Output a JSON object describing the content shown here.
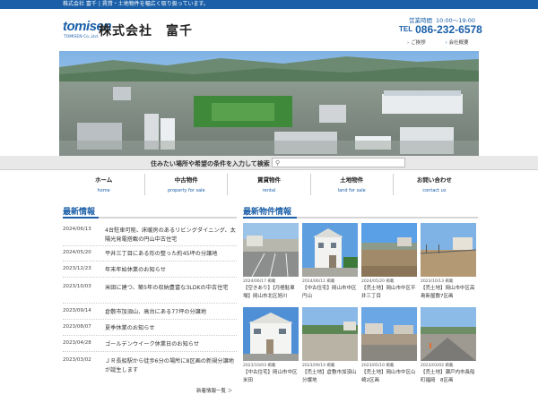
{
  "topbar": {
    "text": "株式会社 富千 | 賃貸・土地物件を幅広く取り扱っています。"
  },
  "header": {
    "logo_mark": "tomisen",
    "logo_sub": "TOMISEN Co.,Ltd.",
    "company_name": "株式会社　富千",
    "hours_label": "営業時間",
    "hours_value": "10:00～19:00",
    "tel_label": "TEL",
    "tel_number": "086-232-6578",
    "links": [
      "ご挨拶",
      "会社概要"
    ]
  },
  "search": {
    "label": "住みたい場所や希望の条件を入力して検索",
    "placeholder": ""
  },
  "nav": [
    {
      "jp": "ホーム",
      "en": "home"
    },
    {
      "jp": "中古物件",
      "en": "property for sale"
    },
    {
      "jp": "賃貸物件",
      "en": "rental"
    },
    {
      "jp": "土地物件",
      "en": "land for sale"
    },
    {
      "jp": "お問い合わせ",
      "en": "contact us"
    }
  ],
  "news": {
    "title": "最新情報",
    "more_label": "新着情報一覧 ＞",
    "items": [
      {
        "date": "2024/06/13",
        "title": "4台駐車可能、床暖房のあるリビングダイニング、太陽光発電搭載の円山中古住宅"
      },
      {
        "date": "2024/05/20",
        "title": "平井三丁目にある形の整った約45坪の分譲地"
      },
      {
        "date": "2023/12/23",
        "title": "年末年始休業のお知らせ"
      },
      {
        "date": "2023/10/03",
        "title": "米田に建つ、築5年の収納豊富な3LDKの中古住宅"
      },
      {
        "date": "2023/09/14",
        "title": "倉敷市加須山、高台にある77坪の分譲地"
      },
      {
        "date": "2023/08/07",
        "title": "夏季休業のお知らせ"
      },
      {
        "date": "2023/04/28",
        "title": "ゴールデンウイーク休業日のお知らせ"
      },
      {
        "date": "2023/03/02",
        "title": "ＪＲ長船駅から徒歩6分の場所に8区画の新規分譲地が誕生します"
      }
    ]
  },
  "properties": {
    "title": "最新物件情報",
    "items": [
      {
        "date": "2024/06/17 掲載",
        "title": "【空きあり】【月極駐車場】岡山市北区旭川",
        "photo": "parking-lot"
      },
      {
        "date": "2024/06/11 掲載",
        "title": "【中古住宅】岡山市中区円山",
        "photo": "white-house"
      },
      {
        "date": "2024/05/20 掲載",
        "title": "【売土地】岡山市中区平井三丁目",
        "photo": "vacant-lot"
      },
      {
        "date": "2023/10/13 掲載",
        "title": "【売土地】岡山市中区高島新屋敷7区画",
        "photo": "vacant-lot-fence"
      },
      {
        "date": "2023/10/03 掲載",
        "title": "【中古住宅】岡山市中区米田",
        "photo": "two-story-house"
      },
      {
        "date": "2023/09/14 掲載",
        "title": "【売土地】倉敷市加須山分譲地",
        "photo": "gravel-lot"
      },
      {
        "date": "2023/05/10 掲載",
        "title": "【売土地】岡山市中区山崎2区画",
        "photo": "paved-lot"
      },
      {
        "date": "2023/03/02 掲載",
        "title": "【売土地】瀬戸内市長船町福岡　8区画",
        "photo": "roadside-lot"
      }
    ]
  },
  "colors": {
    "brand": "#1a5fa8",
    "band": "#e8e8e8"
  }
}
